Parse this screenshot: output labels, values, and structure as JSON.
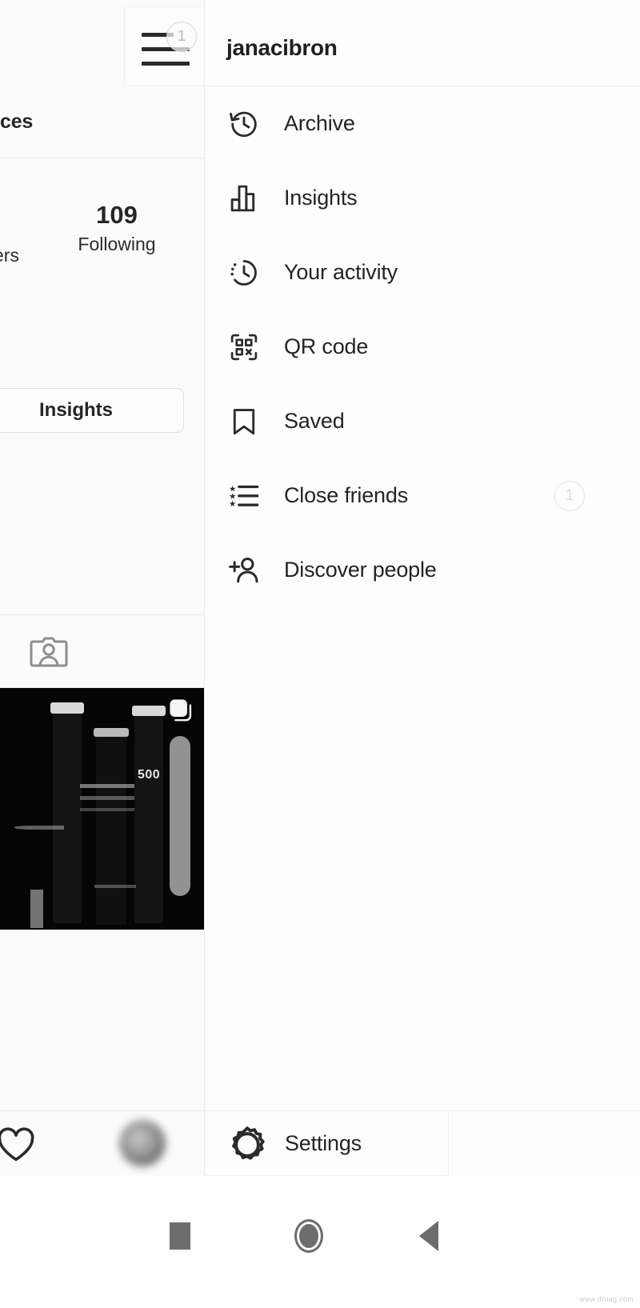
{
  "header": {
    "username": "janacibron",
    "hamburger_badge": "1"
  },
  "profile": {
    "bio_fragment": "ces",
    "stats": [
      {
        "label": "ers",
        "value": ""
      },
      {
        "label": "Following",
        "value": "109"
      }
    ],
    "insights_button": "Insights",
    "tagged_icon": "tagged-person-icon",
    "post": {
      "overlay_text": "500",
      "multipost_icon": "multi-post-icon"
    }
  },
  "menu": {
    "items": [
      {
        "label": "Archive",
        "icon": "archive-clock-icon",
        "badge": ""
      },
      {
        "label": "Insights",
        "icon": "bar-chart-icon",
        "badge": ""
      },
      {
        "label": "Your activity",
        "icon": "activity-clock-icon",
        "badge": ""
      },
      {
        "label": "QR code",
        "icon": "qr-code-icon",
        "badge": ""
      },
      {
        "label": "Saved",
        "icon": "bookmark-icon",
        "badge": ""
      },
      {
        "label": "Close friends",
        "icon": "star-list-icon",
        "badge": "1"
      },
      {
        "label": "Discover people",
        "icon": "add-person-icon",
        "badge": ""
      }
    ],
    "settings": {
      "label": "Settings",
      "icon": "gear-icon"
    }
  },
  "bottom_bar": {
    "heart_icon": "heart-icon",
    "avatar": "profile-avatar"
  },
  "system_nav": {
    "recent_apps": "square-icon",
    "home": "circle-icon",
    "back": "triangle-back-icon"
  },
  "watermark": "www.druag.com",
  "colors": {
    "background": "#fdfdfd",
    "panel": "#fbfbfb",
    "text_primary": "#242424",
    "text_muted": "#b8b8b8",
    "divider": "#ececec",
    "photo_dark": "#050505"
  }
}
